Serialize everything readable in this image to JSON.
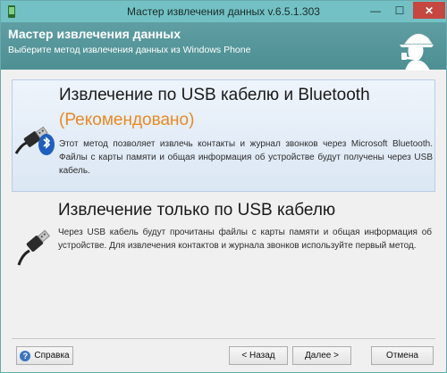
{
  "window": {
    "title": "Мастер извлечения данных v.6.5.1.303",
    "controls": {
      "minimize": "—",
      "maximize": "☐",
      "close": "✕"
    }
  },
  "header": {
    "title": "Мастер извлечения данных",
    "subtitle": "Выберите метод извлечения данных из Windows Phone",
    "icon": "detective-icon"
  },
  "options": [
    {
      "title": "Извлечение по USB кабелю и Bluetooth",
      "recommended": "(Рекомендовано)",
      "description": "Этот метод позволяет извлечь контакты и журнал звонков через Microsoft Bluetooth. Файлы с карты памяти и общая информация об устройстве будут получены через USB кабель.",
      "icon": "usb-bluetooth-icon",
      "selected": true
    },
    {
      "title": "Извлечение только по USB кабелю",
      "description": "Через USB кабель будут прочитаны файлы с карты памяти и общая информация об устройстве. Для извлечения контактов и журнала звонков используйте первый метод.",
      "icon": "usb-cable-icon",
      "selected": false
    }
  ],
  "footer": {
    "help": "Справка",
    "back": "< Назад",
    "next": "Далее >",
    "cancel": "Отмена"
  },
  "colors": {
    "titlebar": "#73c1c4",
    "header": "#5f9ea2",
    "selected_option": "#dbe7f4",
    "recommended": "#e88a24"
  }
}
